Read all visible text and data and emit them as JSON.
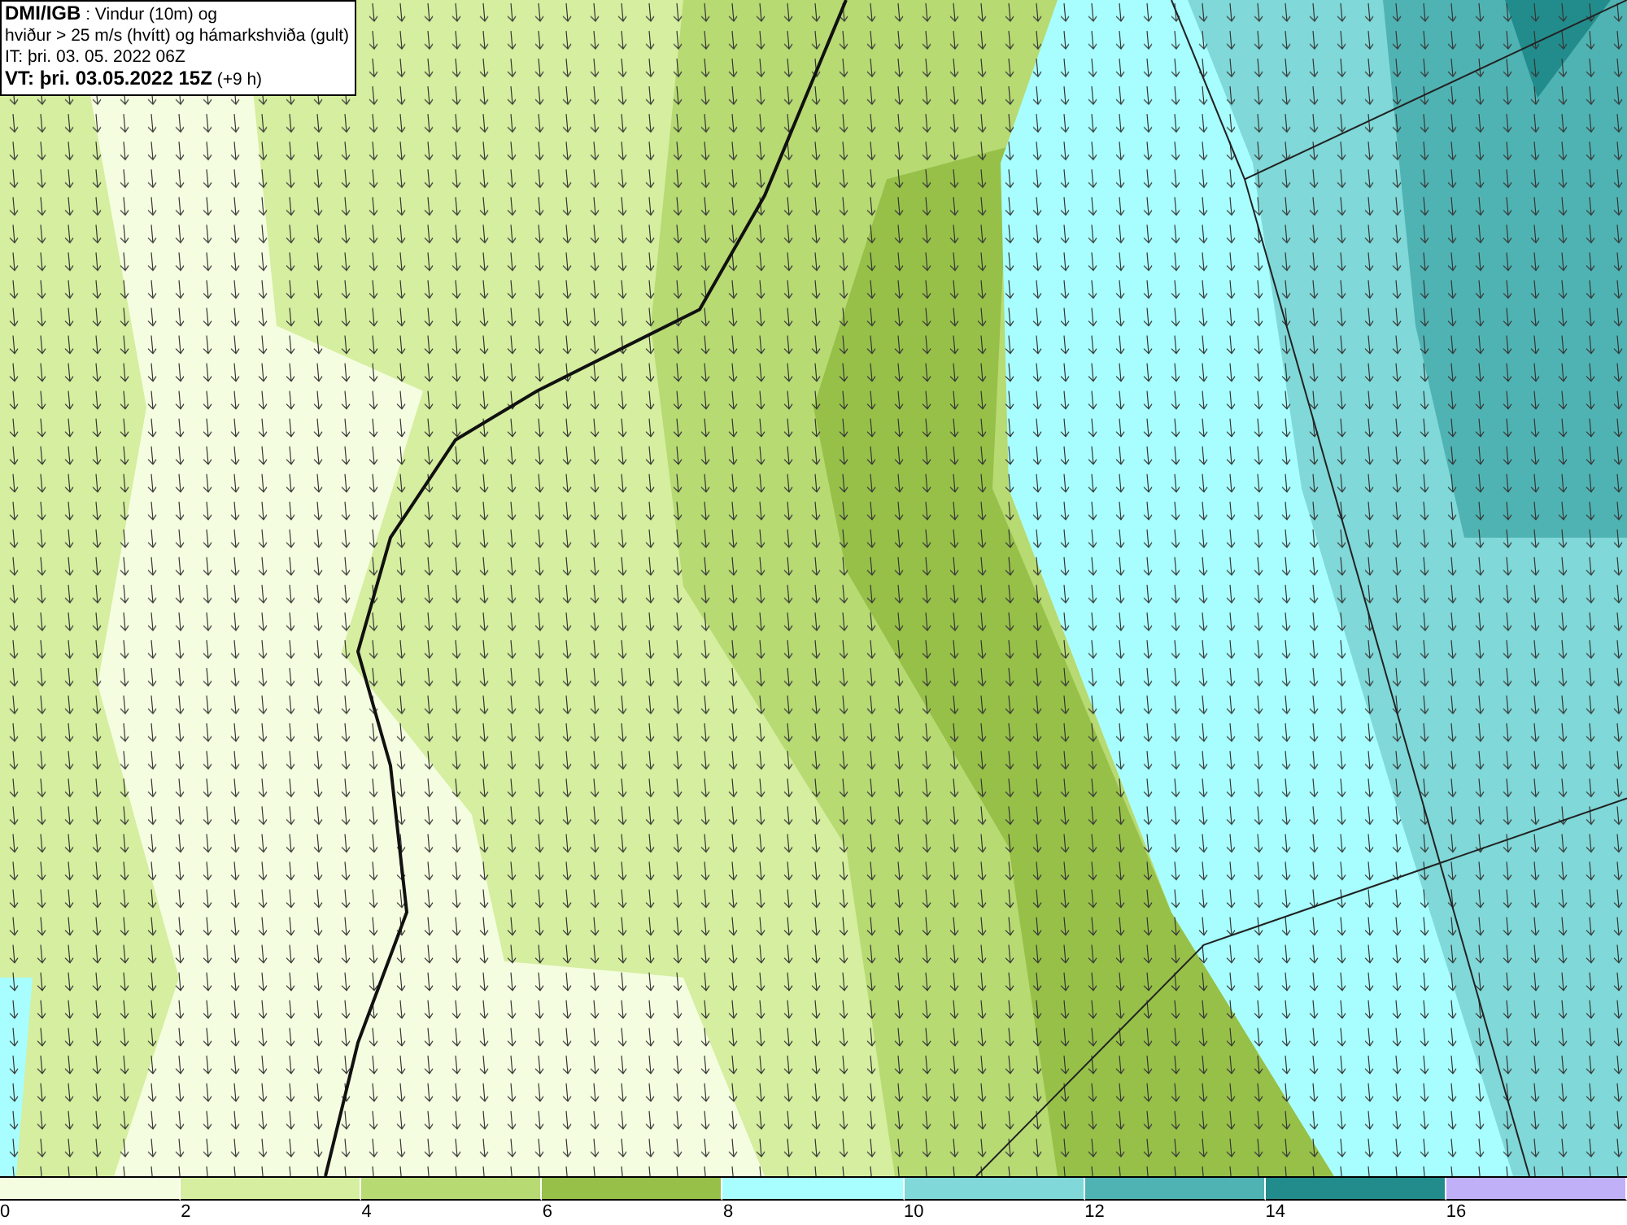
{
  "legend": {
    "lines": [
      "**DMI/IGB** : Vindur (10m) og",
      "hviður > 25 m/s (hvítt) og hámarkshviða (gult)",
      "IT: þri. 03. 05. 2022 06Z",
      "**VT: þri. 03.05.2022 15Z** (+9 h)"
    ]
  },
  "colorbar": {
    "bins": [
      {
        "color": "#f5fde0",
        "label": "0"
      },
      {
        "color": "#d5ee9f",
        "label": "2"
      },
      {
        "color": "#b7da73",
        "label": "4"
      },
      {
        "color": "#97c049",
        "label": "6"
      },
      {
        "color": "#a8fefe",
        "label": "8"
      },
      {
        "color": "#80d8d8",
        "label": "10"
      },
      {
        "color": "#50b3b3",
        "label": "12"
      },
      {
        "color": "#228c8c",
        "label": "14"
      },
      {
        "color": "#c0b0f8",
        "label": "16"
      }
    ]
  }
}
